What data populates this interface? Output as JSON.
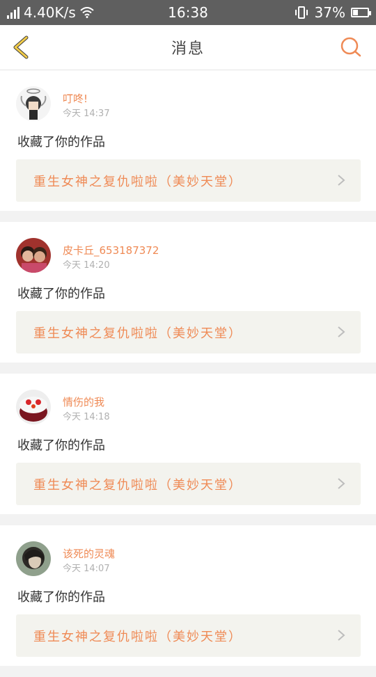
{
  "status_bar": {
    "network_speed": "4.40K/s",
    "time": "16:38",
    "battery_percent": "37%",
    "battery_level": 0.37
  },
  "header": {
    "title": "消息",
    "back_icon": "back-chevron-icon",
    "search_icon": "search-icon",
    "accent_color": "#ef8a55"
  },
  "notifications": [
    {
      "username": "叮咚!",
      "time": "今天 14:37",
      "action": "收藏了你的作品",
      "work_title": "重生女神之复仇啦啦（美妙天堂）"
    },
    {
      "username": "皮卡丘_653187372",
      "time": "今天 14:20",
      "action": "收藏了你的作品",
      "work_title": "重生女神之复仇啦啦（美妙天堂）"
    },
    {
      "username": "情伤的我",
      "time": "今天 14:18",
      "action": "收藏了你的作品",
      "work_title": "重生女神之复仇啦啦（美妙天堂）"
    },
    {
      "username": "该死的灵魂",
      "time": "今天 14:07",
      "action": "收藏了你的作品",
      "work_title": "重生女神之复仇啦啦（美妙天堂）"
    }
  ]
}
